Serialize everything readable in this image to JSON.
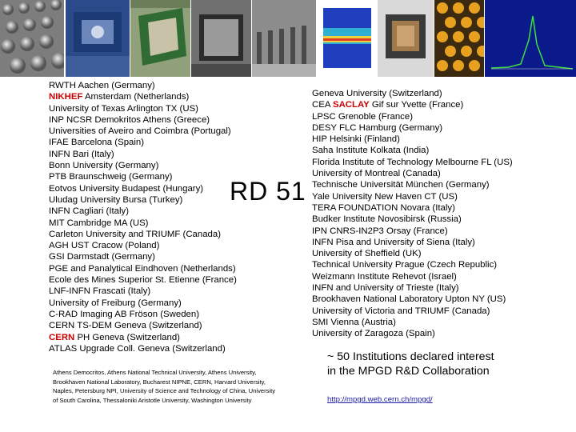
{
  "left_column": [
    {
      "text": "RWTH Aachen (Germany)"
    },
    {
      "highlight": "NIKHEF",
      "text": " Amsterdam (Netherlands)"
    },
    {
      "text": "University of Texas Arlington TX (US)"
    },
    {
      "text": "INP NCSR Demokritos Athens (Greece)"
    },
    {
      "text": "Universities of Aveiro and Coimbra (Portugal)"
    },
    {
      "text": "IFAE Barcelona (Spain)"
    },
    {
      "text": "INFN Bari (Italy)"
    },
    {
      "text": "Bonn University (Germany)"
    },
    {
      "text": "PTB Braunschweig (Germany)"
    },
    {
      "text": "Eotvos University Budapest (Hungary)"
    },
    {
      "text": "Uludag University Bursa (Turkey)"
    },
    {
      "text": "INFN Cagliari (Italy)"
    },
    {
      "text": "MIT Cambridge MA (US)"
    },
    {
      "text": "Carleton University and TRIUMF (Canada)"
    },
    {
      "text": "AGH UST Cracow (Poland)"
    },
    {
      "text": "GSI Darmstadt (Germany)"
    },
    {
      "text": "PGE and Panalytical Eindhoven (Netherlands)"
    },
    {
      "text": "Ecole des Mines Superior St. Etienne (France)"
    },
    {
      "text": "LNF-INFN Frascati (Italy)"
    },
    {
      "text": "University of Freiburg (Germany)"
    },
    {
      "text": "C-RAD Imaging AB Fröson (Sweden)"
    },
    {
      "text": "CERN TS-DEM Geneva (Switzerland)"
    },
    {
      "highlight": "CERN",
      "text": " PH Geneva (Switzerland)"
    },
    {
      "text": "ATLAS Upgrade Coll. Geneva (Switzerland)"
    }
  ],
  "right_column": [
    {
      "text": "Geneva University (Switzerland)"
    },
    {
      "prefix": "CEA ",
      "highlight": "SACLAY",
      "text": " Gif sur Yvette (France)"
    },
    {
      "text": "LPSC Grenoble (France)"
    },
    {
      "text": "DESY FLC Hamburg (Germany)"
    },
    {
      "text": "HIP Helsinki (Finland)"
    },
    {
      "text": "Saha Institute Kolkata (India)"
    },
    {
      "text": "Florida Institute of Technology Melbourne FL (US)"
    },
    {
      "text": "University of Montreal (Canada)"
    },
    {
      "text": "Technische Universität München (Germany)"
    },
    {
      "text": "Yale University New Haven CT (US)"
    },
    {
      "text": "TERA FOUNDATION Novara (Italy)"
    },
    {
      "text": "Budker Institute Novosibirsk (Russia)"
    },
    {
      "text": "IPN CNRS-IN2P3 Orsay (France)"
    },
    {
      "text": "INFN Pisa and University of Siena (Italy)"
    },
    {
      "text": "University of Sheffield (UK)"
    },
    {
      "text": "Technical University Prague (Czech Republic)"
    },
    {
      "text": "Weizmann Institute Rehevot (Israel)"
    },
    {
      "text": "INFN and University of Trieste (Italy)"
    },
    {
      "text": "Brookhaven National Laboratory Upton NY (US)"
    },
    {
      "text": "University of Victoria and TRIUMF (Canada)"
    },
    {
      "text": "SMI Vienna (Austria)"
    },
    {
      "text": "University of Zaragoza (Spain)"
    }
  ],
  "center_label": "RD 51",
  "small_note": "Athens Democritos, Athens National Technical University, Athens University, Brookhaven National Laboratory, Bucharest NIPNE, CERN, Harvard University, Naples, Petersburg NPI, University of Science and Technology of China, University of South Carolina, Thessaloniki Aristotle University, Washington University",
  "declared_line1": "~ 50 Institutions declared interest",
  "declared_line2": "in the MPGD R&D Collaboration",
  "link": "http://mpgd.web.cern.ch/mpgd/",
  "colors": {
    "highlight": "#cc0000",
    "link": "#1a1aa6"
  }
}
